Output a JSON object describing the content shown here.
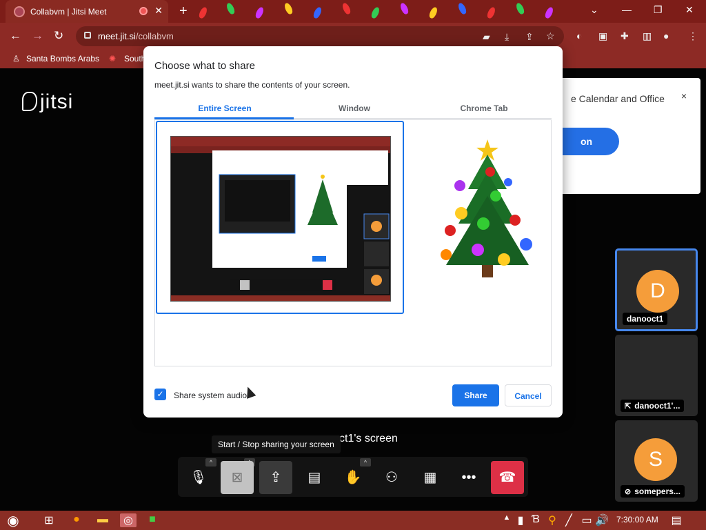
{
  "browser": {
    "tab_title": "Collabvm | Jitsi Meet",
    "tab_close": "✕",
    "new_tab": "+",
    "window_controls": [
      "⌄",
      "—",
      "❐",
      "✕"
    ],
    "url_host": "meet.jit.si",
    "url_path": "/collabvm",
    "bookmarks": [
      "Santa Bombs Arabs",
      "South"
    ]
  },
  "jitsi": {
    "logo_text": "jitsi",
    "notification": {
      "text": "e Calendar and Office",
      "button_label": "on",
      "close": "×"
    },
    "screen_label": "ct1's screen",
    "tooltip": "Start / Stop sharing your screen",
    "participants": [
      {
        "initial": "D",
        "name": "danooct1"
      },
      {
        "initial": "",
        "name": "danooct1'..."
      },
      {
        "initial": "S",
        "name": "somepers..."
      }
    ]
  },
  "dialog": {
    "title": "Choose what to share",
    "subtitle": "meet.jit.si wants to share the contents of your screen.",
    "tabs": [
      "Entire Screen",
      "Window",
      "Chrome Tab"
    ],
    "selected_tab": "Entire Screen",
    "checkbox_label": "Share system audio",
    "checkbox_checked": true,
    "share_button": "Share",
    "cancel_button": "Cancel"
  },
  "taskbar": {
    "clock": "7:30:00 AM"
  },
  "colors": {
    "accent": "#1a73e8",
    "hangup": "#dd3046",
    "avatar": "#f59d3a",
    "browser_frame": "#8d2a25"
  },
  "icons": [
    "microphone-icon",
    "camera-off-icon",
    "screenshare-icon",
    "chat-icon",
    "raise-hand-icon",
    "participants-icon",
    "tile-view-icon",
    "more-icon",
    "hangup-icon"
  ]
}
